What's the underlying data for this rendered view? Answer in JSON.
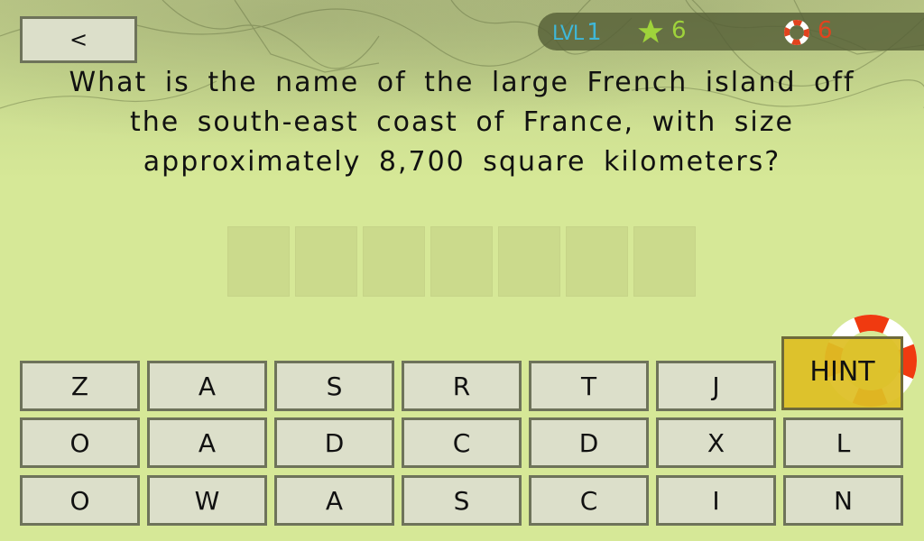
{
  "header": {
    "back_label": "<",
    "level_prefix": "LVL",
    "level_value": "1",
    "stars_count": "6",
    "lives_count": "6"
  },
  "colors": {
    "background": "#d6e897",
    "level": "#3fb7d8",
    "stars": "#9fd33b",
    "lives": "#e2431e",
    "hint": "#debe23",
    "key": "#dcdfca"
  },
  "question": {
    "text": "What is the name of the large French island off the south-east coast of France, with size approximately 8,700 square kilometers?"
  },
  "answer": {
    "slot_count": 7,
    "slots": [
      "",
      "",
      "",
      "",
      "",
      "",
      ""
    ]
  },
  "keyboard": {
    "rows": [
      [
        "Z",
        "A",
        "S",
        "R",
        "T",
        "J"
      ],
      [
        "O",
        "A",
        "D",
        "C",
        "D",
        "X",
        "L"
      ],
      [
        "O",
        "W",
        "A",
        "S",
        "C",
        "I",
        "N"
      ]
    ]
  },
  "hint": {
    "label": "HINT"
  }
}
